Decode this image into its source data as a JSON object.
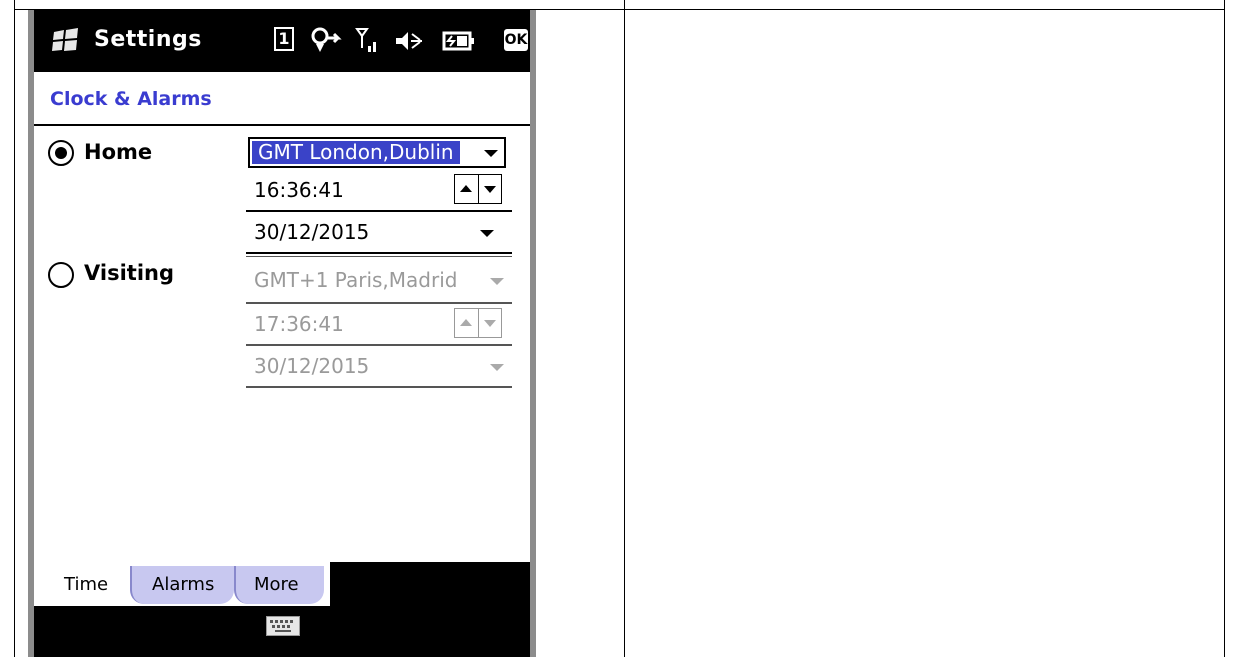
{
  "device": {
    "title": "Settings",
    "ok_label": "OK",
    "status_icons": [
      "sim-1-icon",
      "connectivity-icon",
      "signal-icon",
      "speaker-icon",
      "battery-icon"
    ],
    "status_sim_number": "1"
  },
  "header": {
    "title": "Clock & Alarms"
  },
  "home": {
    "label": "Home",
    "selected": true,
    "timezone": "GMT London,Dublin",
    "time": "16:36:41",
    "date": "30/12/2015"
  },
  "visiting": {
    "label": "Visiting",
    "selected": false,
    "timezone": "GMT+1 Paris,Madrid",
    "time": "17:36:41",
    "date": "30/12/2015"
  },
  "tabs": [
    {
      "label": "Time",
      "active": true
    },
    {
      "label": "Alarms",
      "active": false
    },
    {
      "label": "More",
      "active": false
    }
  ],
  "colors": {
    "header_text": "#3a3cd0",
    "selection": "#3a43c8",
    "tab_inactive": "#c8c8f0",
    "disabled_text": "#9a9a9a"
  }
}
